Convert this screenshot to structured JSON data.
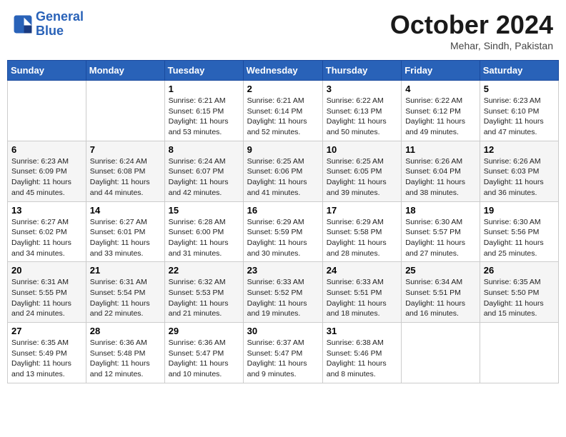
{
  "header": {
    "logo_line1": "General",
    "logo_line2": "Blue",
    "month": "October 2024",
    "location": "Mehar, Sindh, Pakistan"
  },
  "weekdays": [
    "Sunday",
    "Monday",
    "Tuesday",
    "Wednesday",
    "Thursday",
    "Friday",
    "Saturday"
  ],
  "weeks": [
    [
      {
        "day": "",
        "info": ""
      },
      {
        "day": "",
        "info": ""
      },
      {
        "day": "1",
        "info": "Sunrise: 6:21 AM\nSunset: 6:15 PM\nDaylight: 11 hours and 53 minutes."
      },
      {
        "day": "2",
        "info": "Sunrise: 6:21 AM\nSunset: 6:14 PM\nDaylight: 11 hours and 52 minutes."
      },
      {
        "day": "3",
        "info": "Sunrise: 6:22 AM\nSunset: 6:13 PM\nDaylight: 11 hours and 50 minutes."
      },
      {
        "day": "4",
        "info": "Sunrise: 6:22 AM\nSunset: 6:12 PM\nDaylight: 11 hours and 49 minutes."
      },
      {
        "day": "5",
        "info": "Sunrise: 6:23 AM\nSunset: 6:10 PM\nDaylight: 11 hours and 47 minutes."
      }
    ],
    [
      {
        "day": "6",
        "info": "Sunrise: 6:23 AM\nSunset: 6:09 PM\nDaylight: 11 hours and 45 minutes."
      },
      {
        "day": "7",
        "info": "Sunrise: 6:24 AM\nSunset: 6:08 PM\nDaylight: 11 hours and 44 minutes."
      },
      {
        "day": "8",
        "info": "Sunrise: 6:24 AM\nSunset: 6:07 PM\nDaylight: 11 hours and 42 minutes."
      },
      {
        "day": "9",
        "info": "Sunrise: 6:25 AM\nSunset: 6:06 PM\nDaylight: 11 hours and 41 minutes."
      },
      {
        "day": "10",
        "info": "Sunrise: 6:25 AM\nSunset: 6:05 PM\nDaylight: 11 hours and 39 minutes."
      },
      {
        "day": "11",
        "info": "Sunrise: 6:26 AM\nSunset: 6:04 PM\nDaylight: 11 hours and 38 minutes."
      },
      {
        "day": "12",
        "info": "Sunrise: 6:26 AM\nSunset: 6:03 PM\nDaylight: 11 hours and 36 minutes."
      }
    ],
    [
      {
        "day": "13",
        "info": "Sunrise: 6:27 AM\nSunset: 6:02 PM\nDaylight: 11 hours and 34 minutes."
      },
      {
        "day": "14",
        "info": "Sunrise: 6:27 AM\nSunset: 6:01 PM\nDaylight: 11 hours and 33 minutes."
      },
      {
        "day": "15",
        "info": "Sunrise: 6:28 AM\nSunset: 6:00 PM\nDaylight: 11 hours and 31 minutes."
      },
      {
        "day": "16",
        "info": "Sunrise: 6:29 AM\nSunset: 5:59 PM\nDaylight: 11 hours and 30 minutes."
      },
      {
        "day": "17",
        "info": "Sunrise: 6:29 AM\nSunset: 5:58 PM\nDaylight: 11 hours and 28 minutes."
      },
      {
        "day": "18",
        "info": "Sunrise: 6:30 AM\nSunset: 5:57 PM\nDaylight: 11 hours and 27 minutes."
      },
      {
        "day": "19",
        "info": "Sunrise: 6:30 AM\nSunset: 5:56 PM\nDaylight: 11 hours and 25 minutes."
      }
    ],
    [
      {
        "day": "20",
        "info": "Sunrise: 6:31 AM\nSunset: 5:55 PM\nDaylight: 11 hours and 24 minutes."
      },
      {
        "day": "21",
        "info": "Sunrise: 6:31 AM\nSunset: 5:54 PM\nDaylight: 11 hours and 22 minutes."
      },
      {
        "day": "22",
        "info": "Sunrise: 6:32 AM\nSunset: 5:53 PM\nDaylight: 11 hours and 21 minutes."
      },
      {
        "day": "23",
        "info": "Sunrise: 6:33 AM\nSunset: 5:52 PM\nDaylight: 11 hours and 19 minutes."
      },
      {
        "day": "24",
        "info": "Sunrise: 6:33 AM\nSunset: 5:51 PM\nDaylight: 11 hours and 18 minutes."
      },
      {
        "day": "25",
        "info": "Sunrise: 6:34 AM\nSunset: 5:51 PM\nDaylight: 11 hours and 16 minutes."
      },
      {
        "day": "26",
        "info": "Sunrise: 6:35 AM\nSunset: 5:50 PM\nDaylight: 11 hours and 15 minutes."
      }
    ],
    [
      {
        "day": "27",
        "info": "Sunrise: 6:35 AM\nSunset: 5:49 PM\nDaylight: 11 hours and 13 minutes."
      },
      {
        "day": "28",
        "info": "Sunrise: 6:36 AM\nSunset: 5:48 PM\nDaylight: 11 hours and 12 minutes."
      },
      {
        "day": "29",
        "info": "Sunrise: 6:36 AM\nSunset: 5:47 PM\nDaylight: 11 hours and 10 minutes."
      },
      {
        "day": "30",
        "info": "Sunrise: 6:37 AM\nSunset: 5:47 PM\nDaylight: 11 hours and 9 minutes."
      },
      {
        "day": "31",
        "info": "Sunrise: 6:38 AM\nSunset: 5:46 PM\nDaylight: 11 hours and 8 minutes."
      },
      {
        "day": "",
        "info": ""
      },
      {
        "day": "",
        "info": ""
      }
    ]
  ]
}
